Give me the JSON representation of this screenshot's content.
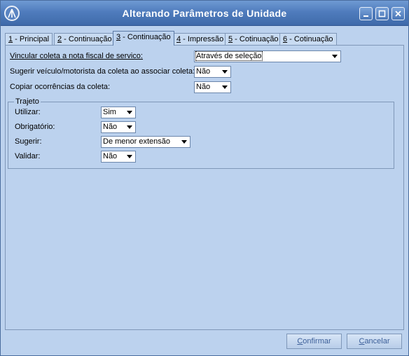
{
  "window": {
    "title": "Alterando Parâmetros de Unidade"
  },
  "tabs": [
    {
      "num": "1",
      "label": " - Principal"
    },
    {
      "num": "2",
      "label": " - Continuação"
    },
    {
      "num": "3",
      "label": " - Continuação"
    },
    {
      "num": "4",
      "label": " - Impressão"
    },
    {
      "num": "5",
      "label": " - Cotinuação"
    },
    {
      "num": "6",
      "label": " - Cotinuação"
    }
  ],
  "active_tab": "3 - Continuação",
  "form": {
    "vincular": {
      "label": "Vincular coleta a nota fiscal de servico:",
      "value": "Através de seleção"
    },
    "sugerir_veiculo": {
      "label": "Sugerir veículo/motorista da coleta ao associar coleta:",
      "value": "Não"
    },
    "copiar": {
      "label": "Copiar ocorrências da coleta:",
      "value": "Não"
    }
  },
  "trajeto": {
    "legend": "Trajeto",
    "utilizar": {
      "label": "Utilizar:",
      "value": "Sim"
    },
    "obrigatorio": {
      "label": "Obrigatório:",
      "value": "Não"
    },
    "sugerir": {
      "label": "Sugerir:",
      "value": "De menor extensão"
    },
    "validar": {
      "label": "Validar:",
      "value": "Não"
    }
  },
  "buttons": {
    "confirm_first": "C",
    "confirm_rest": "onfirmar",
    "cancel_first": "C",
    "cancel_rest": "ancelar"
  },
  "colors": {
    "window_bg": "#bcd2ee",
    "titlebar": "#4f7cbd",
    "button_text": "#3c5f99"
  },
  "icons": [
    "app-logo-icon",
    "minimize-icon",
    "maximize-icon",
    "close-icon",
    "chevron-down-icon"
  ]
}
